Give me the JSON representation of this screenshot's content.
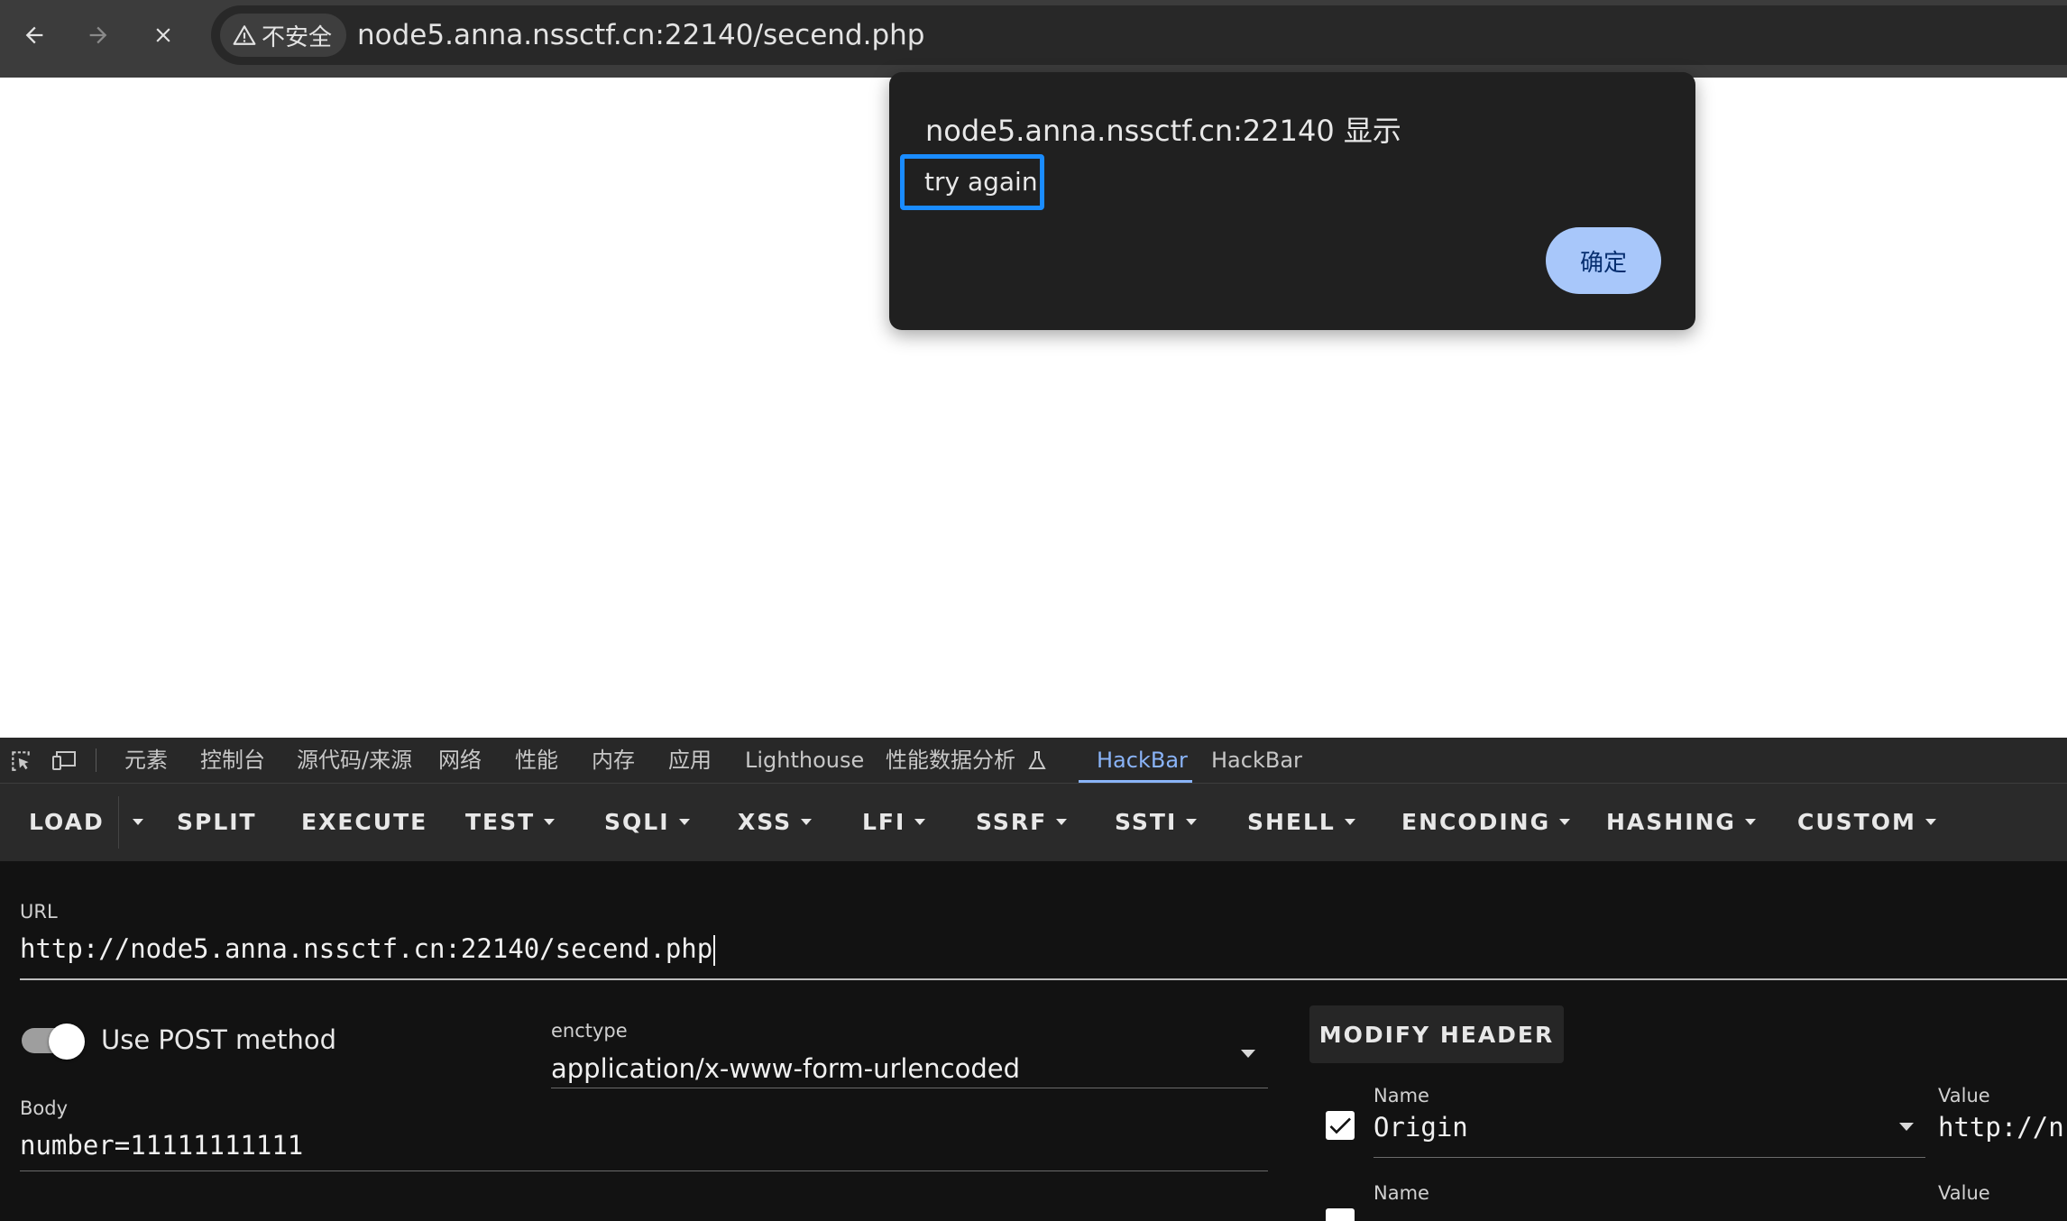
{
  "browser": {
    "security_label": "不安全",
    "address": "node5.anna.nssctf.cn:22140/secend.php"
  },
  "dialog": {
    "title": "node5.anna.nssctf.cn:22140 显示",
    "message": "try again",
    "ok_label": "确定"
  },
  "devtools": {
    "tabs": [
      "元素",
      "控制台",
      "源代码/来源",
      "网络",
      "性能",
      "内存",
      "应用",
      "Lighthouse",
      "性能数据分析",
      "HackBar",
      "HackBar"
    ],
    "active_tab": "HackBar"
  },
  "hackbar": {
    "toolbar": [
      "LOAD",
      "SPLIT",
      "EXECUTE",
      "TEST",
      "SQLI",
      "XSS",
      "LFI",
      "SSRF",
      "SSTI",
      "SHELL",
      "ENCODING",
      "HASHING",
      "CUSTOM"
    ],
    "url_label": "URL",
    "url_value": "http://node5.anna.nssctf.cn:22140/secend.php",
    "post_toggle_label": "Use POST method",
    "post_enabled": true,
    "enctype_label": "enctype",
    "enctype_value": "application/x-www-form-urlencoded",
    "modify_header_label": "MODIFY HEADER",
    "body_label": "Body",
    "body_value": "number=11111111111",
    "headers": [
      {
        "name_label": "Name",
        "name": "Origin",
        "value_label": "Value",
        "value": "http://n",
        "checked": true
      },
      {
        "name_label": "Name",
        "name": "",
        "value_label": "Value",
        "value": "",
        "checked": true
      }
    ]
  }
}
